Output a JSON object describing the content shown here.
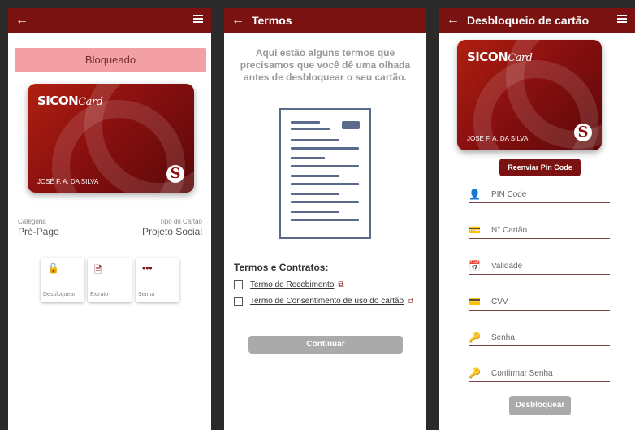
{
  "screen1": {
    "status": "Bloqueado",
    "card": {
      "brand": "SICON",
      "brand_script": "Card",
      "holder": "JOSÉ F. A. DA SILVA",
      "logo": "S"
    },
    "category_label": "Categoria",
    "category_value": "Pré-Pago",
    "type_label": "Tipo do Cartão",
    "type_value": "Projeto Social",
    "tiles": [
      {
        "label": "Desbloquear",
        "icon": "lock-icon",
        "glyph": "🔓"
      },
      {
        "label": "Extrato",
        "icon": "document-icon",
        "glyph": "🗎"
      },
      {
        "label": "Senha",
        "icon": "dots-icon",
        "glyph": "•••"
      }
    ]
  },
  "screen2": {
    "title": "Termos",
    "intro": "Aqui estão alguns termos que precisamos que você dê uma olhada antes de desbloquear o seu cartão.",
    "section_title": "Termos e Contratos:",
    "terms": [
      {
        "label": "Termo de Recebimento"
      },
      {
        "label": "Termo de Consentimento de uso do cartão"
      }
    ],
    "continue_label": "Continuar"
  },
  "screen3": {
    "title": "Desbloqueio de cartão",
    "card": {
      "brand": "SICON",
      "brand_script": "Card",
      "holder": "JOSÉ F. A. DA SILVA",
      "logo": "S"
    },
    "resend_label": "Reenviar Pin Code",
    "fields": [
      {
        "label": "PIN Code",
        "icon": "person-key-icon",
        "glyph": "👤"
      },
      {
        "label": "N° Cartão",
        "icon": "card-icon",
        "glyph": "💳"
      },
      {
        "label": "Validade",
        "icon": "calendar-icon",
        "glyph": "📅"
      },
      {
        "label": "CVV",
        "icon": "card-icon",
        "glyph": "💳"
      },
      {
        "label": "Senha",
        "icon": "key-icon",
        "glyph": "🔑"
      },
      {
        "label": "Confirmar Senha",
        "icon": "key-icon",
        "glyph": "🔑"
      }
    ],
    "unlock_label": "Desbloquear"
  },
  "colors": {
    "primary": "#7a1212",
    "blocked": "#f2a0a6",
    "disabled": "#aaaaaa"
  }
}
